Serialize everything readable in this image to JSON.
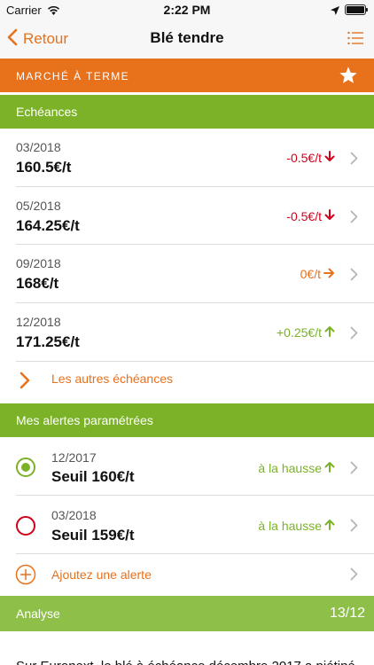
{
  "status_bar": {
    "carrier": "Carrier",
    "time": "2:22 PM"
  },
  "nav": {
    "back_label": "Retour",
    "title": "Blé tendre"
  },
  "banner": {
    "title": "MARCHÉ À TERME"
  },
  "echeances": {
    "header": "Echéances",
    "items": [
      {
        "date": "03/2018",
        "price": "160.5€/t",
        "change": "-0.5€/t",
        "trend": "down"
      },
      {
        "date": "05/2018",
        "price": "164.25€/t",
        "change": "-0.5€/t",
        "trend": "down"
      },
      {
        "date": "09/2018",
        "price": "168€/t",
        "change": "0€/t",
        "trend": "flat"
      },
      {
        "date": "12/2018",
        "price": "171.25€/t",
        "change": "+0.25€/t",
        "trend": "up"
      }
    ],
    "more_link": "Les autres échéances"
  },
  "alerts": {
    "header": "Mes alertes paramétrées",
    "items": [
      {
        "date": "12/2017",
        "threshold": "Seuil 160€/t",
        "direction": "à la hausse",
        "active": true
      },
      {
        "date": "03/2018",
        "threshold": "Seuil 159€/t",
        "direction": "à la hausse",
        "active": false
      }
    ],
    "add_label": "Ajoutez une alerte"
  },
  "analyse": {
    "header": "Analyse",
    "date": "13/12",
    "text": "Sur Euronext, le blé à échéance décembre 2017 a piétiné"
  },
  "colors": {
    "orange": "#e8711c",
    "green": "#7bb227",
    "red": "#d0021b"
  },
  "icons": {
    "back": "chevron-left-icon",
    "menu": "list-icon",
    "favorite": "star-icon",
    "row": "chevron-right-icon",
    "down": "arrow-down-icon",
    "flat": "arrow-right-icon",
    "up": "arrow-up-icon",
    "add": "plus-circle-icon"
  }
}
